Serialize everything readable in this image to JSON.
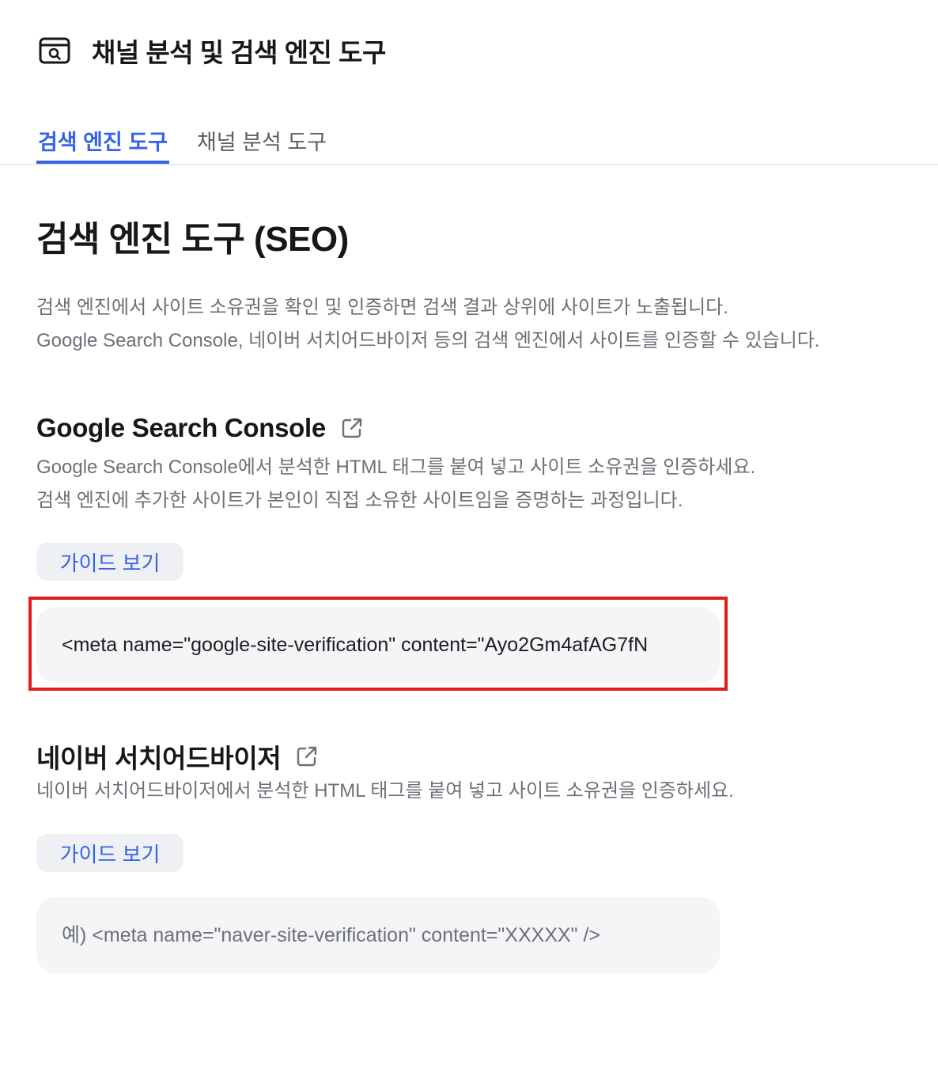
{
  "header": {
    "icon": "browser-search-icon",
    "title": "채널 분석 및 검색 엔진 도구"
  },
  "tabs": [
    {
      "label": "검색 엔진 도구",
      "active": true
    },
    {
      "label": "채널 분석 도구",
      "active": false
    }
  ],
  "page": {
    "title": "검색 엔진 도구 (SEO)",
    "intro_line1": "검색 엔진에서 사이트 소유권을 확인 및 인증하면 검색 결과 상위에 사이트가 노출됩니다.",
    "intro_line2": "Google Search Console, 네이버 서치어드바이저 등의 검색 엔진에서 사이트를 인증할 수 있습니다."
  },
  "google": {
    "title": "Google Search Console",
    "link_icon": "external-link-icon",
    "desc_line1": "Google Search Console에서 분석한 HTML 태그를 붙여 넣고 사이트 소유권을 인증하세요.",
    "desc_line2": "검색 엔진에 추가한 사이트가 본인이 직접 소유한 사이트임을 증명하는 과정입니다.",
    "guide_label": "가이드 보기",
    "value": "<meta name=\"google-site-verification\" content=\"Ayo2Gm4afAG7fN"
  },
  "naver": {
    "title": "네이버 서치어드바이저",
    "link_icon": "external-link-icon",
    "desc_line1": "네이버 서치어드바이저에서 분석한 HTML 태그를 붙여 넣고 사이트 소유권을 인증하세요.",
    "guide_label": "가이드 보기",
    "placeholder": "예) <meta name=\"naver-site-verification\" content=\"XXXXX\" />"
  },
  "colors": {
    "accent": "#3562e8",
    "highlight": "#e01c1c",
    "field_bg": "#f4f5f7",
    "muted_text": "#6e7079"
  }
}
